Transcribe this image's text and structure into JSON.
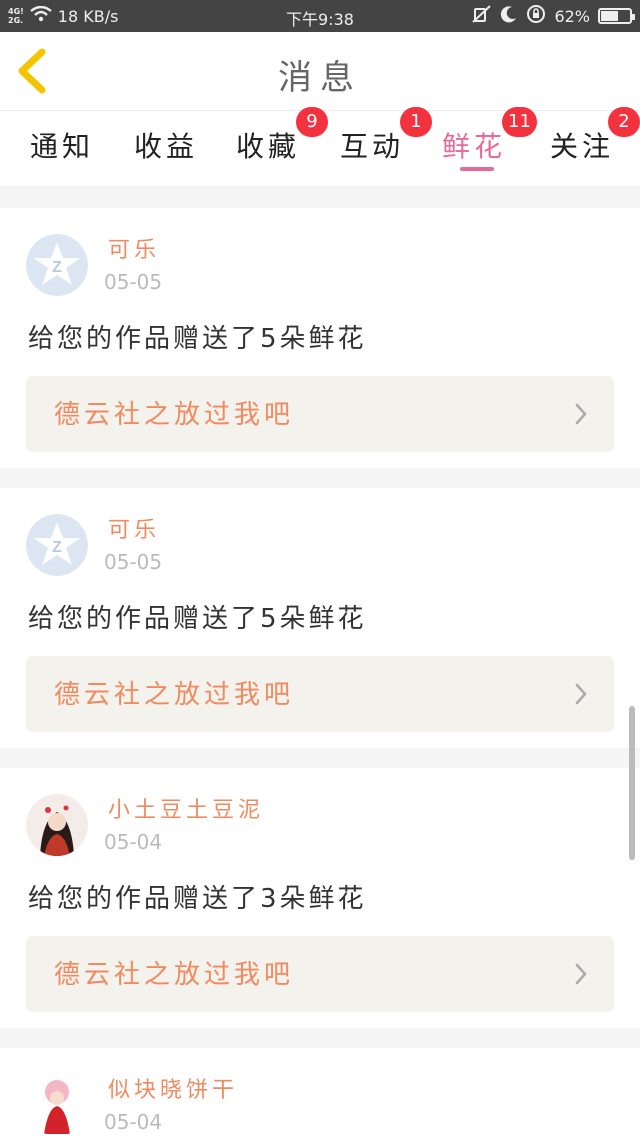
{
  "status_bar": {
    "net_top": "4G!",
    "net_bottom": "2G.",
    "speed": "18 KB/s",
    "time": "下午9:38",
    "battery": "62%",
    "battery_fraction": 0.62
  },
  "header": {
    "title": "消息"
  },
  "tabs": [
    {
      "label": "通知",
      "badge": ""
    },
    {
      "label": "收益",
      "badge": ""
    },
    {
      "label": "收藏",
      "badge": "9"
    },
    {
      "label": "互动",
      "badge": "1"
    },
    {
      "label": "鲜花",
      "badge": "11"
    },
    {
      "label": "关注",
      "badge": "2"
    }
  ],
  "active_tab": "鲜花",
  "messages": [
    {
      "user": "可乐",
      "date": "05-05",
      "text": "给您的作品赠送了5朵鲜花",
      "work": "德云社之放过我吧",
      "avatar": "default-q-avatar"
    },
    {
      "user": "可乐",
      "date": "05-05",
      "text": "给您的作品赠送了5朵鲜花",
      "work": "德云社之放过我吧",
      "avatar": "default-q-avatar"
    },
    {
      "user": "小土豆土豆泥",
      "date": "05-04",
      "text": "给您的作品赠送了3朵鲜花",
      "work": "德云社之放过我吧",
      "avatar": "illustrated-avatar"
    },
    {
      "user": "似块晓饼干",
      "date": "05-04",
      "text": "",
      "work": "",
      "avatar": "illustrated-avatar"
    }
  ],
  "colors": {
    "accent": "#e66a9a",
    "name_orange": "#f08a60",
    "badge_red": "#f2323f",
    "back_yellow": "#f5c400"
  }
}
